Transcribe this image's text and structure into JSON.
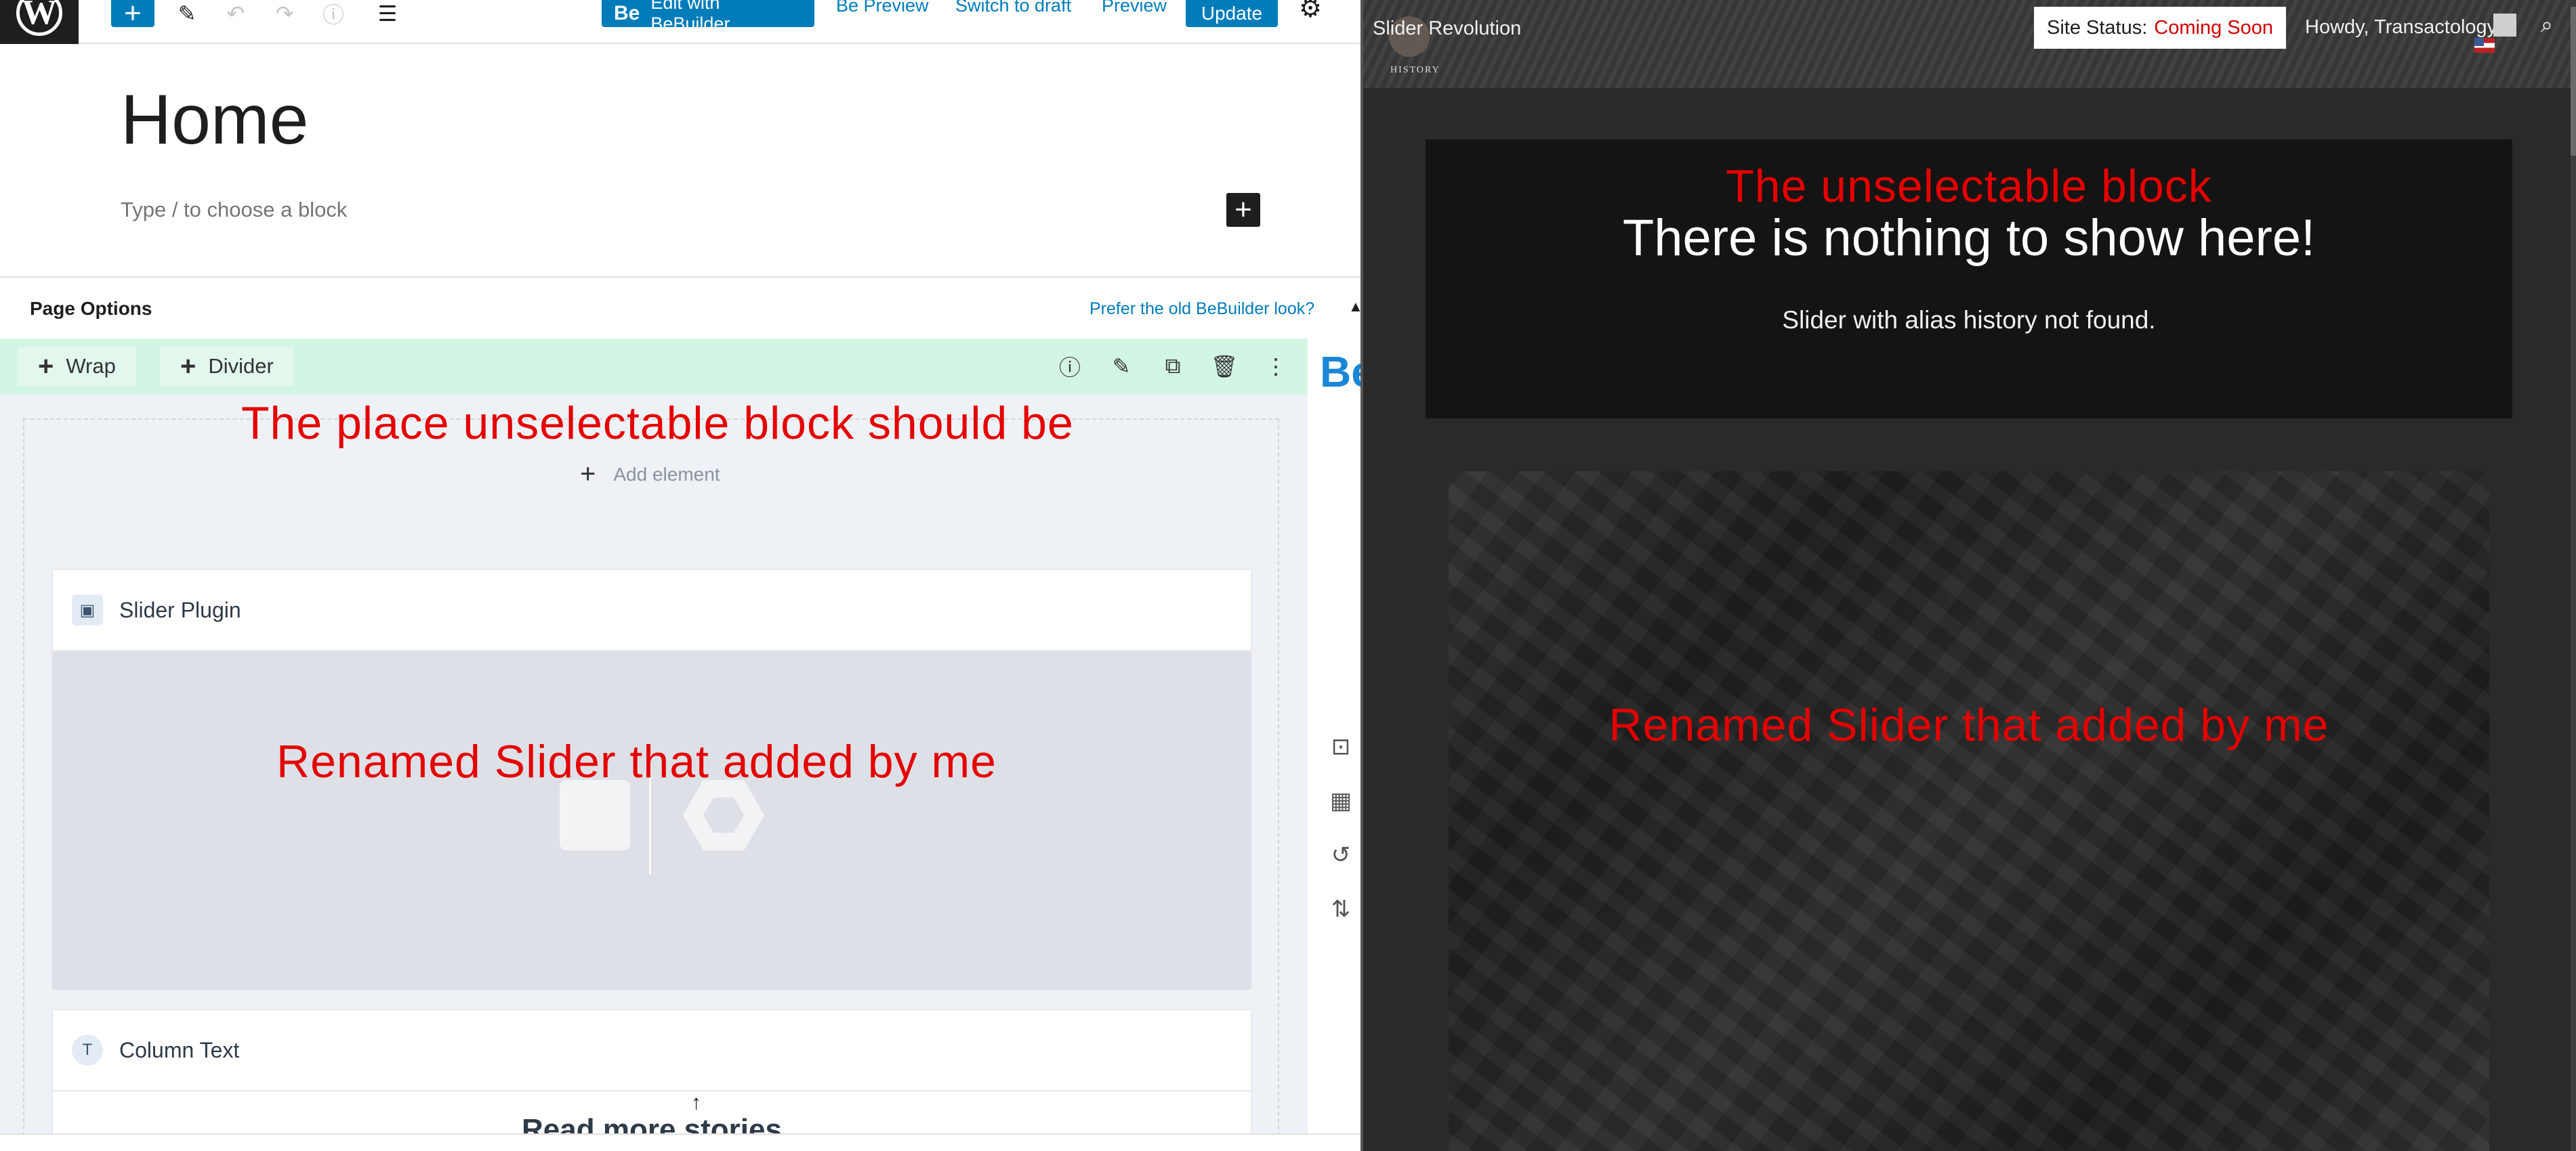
{
  "editor": {
    "toolbar": {
      "bebuilder_prefix": "Be",
      "bebuilder_label": "Edit with BeBuilder",
      "be_preview": "Be Preview",
      "switch_to_draft": "Switch to draft",
      "preview": "Preview",
      "update": "Update"
    },
    "title": "Home",
    "block_placeholder": "Type / to choose a block",
    "page_options": {
      "title": "Page Options",
      "old_look_link": "Prefer the old BeBuilder look?"
    },
    "wrap_toolbar": {
      "wrap_label": "Wrap",
      "divider_label": "Divider"
    },
    "be_mark": "Be",
    "add_element": "Add element",
    "elements": [
      {
        "name": "Slider Plugin"
      },
      {
        "name": "Column Text",
        "content": "Read more stories"
      }
    ],
    "annotations": {
      "place": "The place unselectable block should be",
      "slider": "Renamed Slider that added by me"
    }
  },
  "preview": {
    "site_name": "Slider Revolution",
    "logo_text": "HISTORY",
    "site_status_label": "Site Status:",
    "site_status_value": "Coming Soon",
    "howdy": "Howdy, Transactology",
    "notice": {
      "annotation": "The unselectable block",
      "title": "There is nothing to show here!",
      "message": "Slider with alias history not found."
    },
    "slider_annotation": "Renamed Slider that added by me"
  },
  "colors": {
    "wp_blue": "#007cba",
    "annotation_red": "#e50000",
    "status_red": "#d00000",
    "wrap_green": "#d3f5e3",
    "be_blue": "#1a86d6"
  },
  "icons": [
    "wordpress-logo-icon",
    "plus-icon",
    "pencil-icon",
    "undo-icon",
    "redo-icon",
    "info-icon",
    "list-view-icon",
    "gear-icon",
    "edit-icon",
    "copy-icon",
    "trash-icon",
    "more-vertical-icon",
    "slider-icon",
    "text-icon",
    "search-icon",
    "avatar-icon",
    "flag-icon"
  ]
}
